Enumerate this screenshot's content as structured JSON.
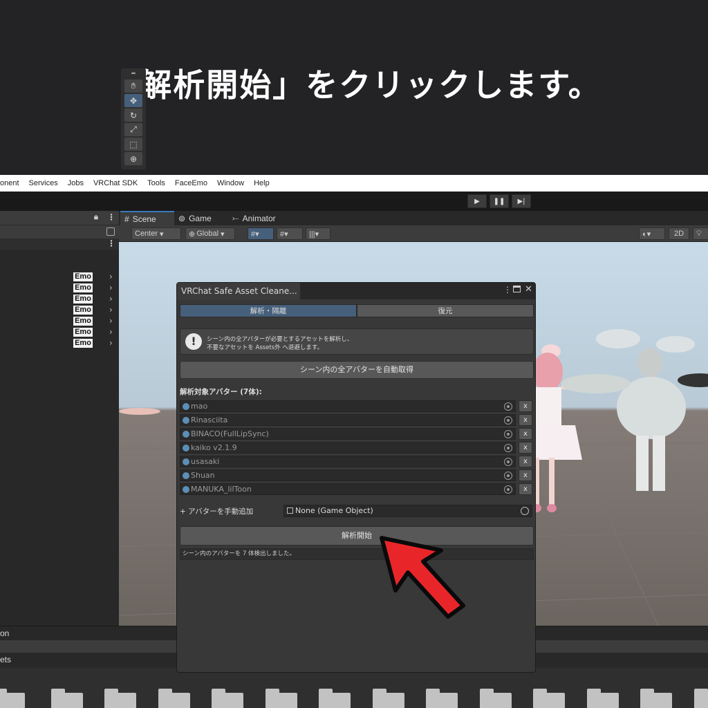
{
  "banner": {
    "text": "「解析開始」をクリックします。"
  },
  "menubar": {
    "items": [
      "onent",
      "Services",
      "Jobs",
      "VRChat SDK",
      "Tools",
      "FaceEmo",
      "Window",
      "Help"
    ]
  },
  "hierarchy": {
    "emo_label": "Emo",
    "emo_count": 7
  },
  "scene_tabs": [
    "Scene",
    "Game",
    "Animator"
  ],
  "scene_toolbar": {
    "center": "Center",
    "global": "Global",
    "mode_2d": "2D"
  },
  "window": {
    "title": "VRChat Safe Asset Cleane...",
    "tabs": [
      "解析・隔離",
      "復元"
    ],
    "help": {
      "line1": "シーン内の全アバターが必要とするアセットを解析し、",
      "line2": "不要なアセットを Assets外 へ退避します。"
    },
    "auto_fetch_button": "シーン内の全アバターを自動取得",
    "avatar_list_header": "解析対象アバター (7体):",
    "avatars": [
      "mao",
      "Rinasciita",
      "BINACO(FullLipSync)",
      "kaiko v2.1.9",
      "usasaki",
      "Shuan",
      "MANUKA_lilToon"
    ],
    "remove_label": "x",
    "add_manual_label": "+ アバターを手動追加",
    "object_field_value": "None (Game Object)",
    "start_button": "解析開始",
    "status": "シーン内のアバターを 7 体検出しました。"
  },
  "bottom": {
    "project_label": "on",
    "assets_label": "ets"
  },
  "colors": {
    "accent_arrow": "#e8262a",
    "selected_tab": "#46607c"
  }
}
